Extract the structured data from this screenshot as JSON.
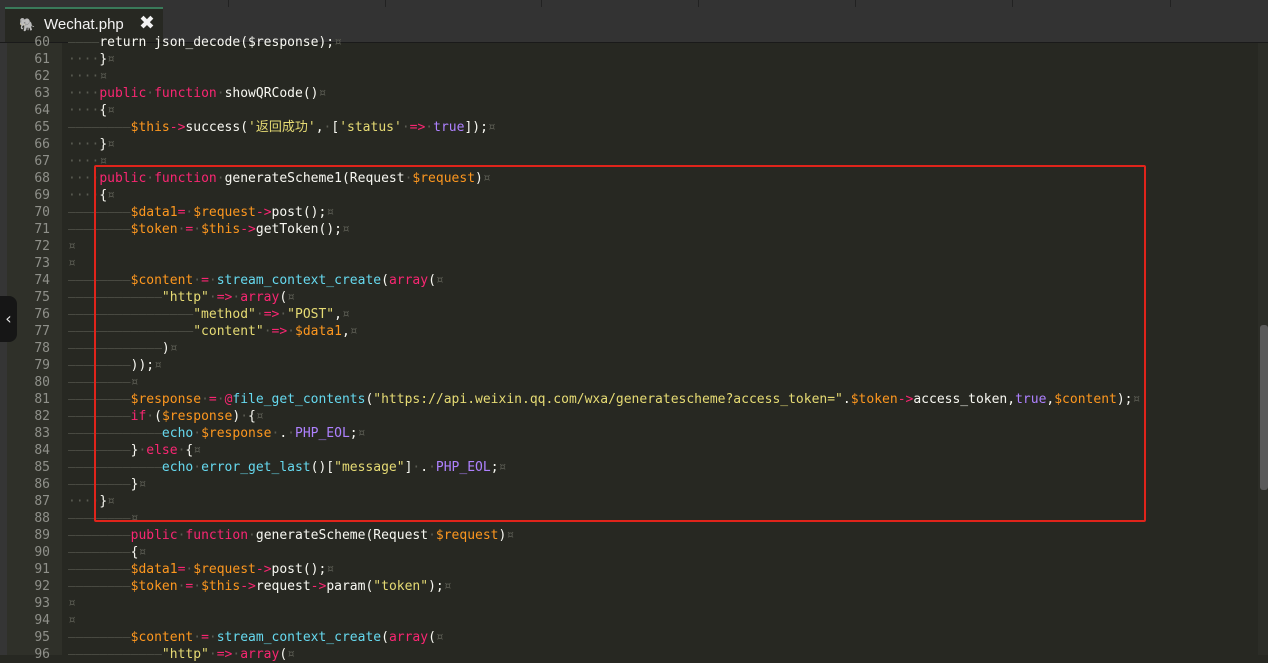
{
  "tab": {
    "title": "Wechat.php",
    "close_glyph": "✖",
    "icon": "elephant-php-icon"
  },
  "colors": {
    "keyword": "#f92672",
    "function": "#66d9ef",
    "variable": "#fd971f",
    "string": "#e6db74",
    "constant": "#ae81ff",
    "highlight_box": "#e0241b"
  },
  "collapse_glyph": "‹",
  "lines": [
    {
      "n": "60",
      "t": [
        [
          "tab",
          "————"
        ],
        [
          "",
          "return json_decode($response);"
        ],
        [
          "pil",
          "¤"
        ]
      ]
    },
    {
      "n": "61",
      "t": [
        [
          "ws",
          "····"
        ],
        [
          "",
          "}"
        ],
        [
          "pil",
          "¤"
        ]
      ]
    },
    {
      "n": "62",
      "t": [
        [
          "ws",
          "····"
        ],
        [
          "pil",
          "¤"
        ]
      ]
    },
    {
      "n": "63",
      "t": [
        [
          "ws",
          "····"
        ],
        [
          "kw",
          "public"
        ],
        [
          "ws",
          "·"
        ],
        [
          "kw",
          "function"
        ],
        [
          "ws",
          "·"
        ],
        [
          "",
          "showQRCode()"
        ],
        [
          "pil",
          "¤"
        ]
      ]
    },
    {
      "n": "64",
      "t": [
        [
          "ws",
          "····"
        ],
        [
          "",
          "{"
        ],
        [
          "pil",
          "¤"
        ]
      ]
    },
    {
      "n": "65",
      "t": [
        [
          "tab",
          "————————"
        ],
        [
          "var",
          "$this"
        ],
        [
          "op",
          "->"
        ],
        [
          "",
          "success("
        ],
        [
          "str",
          "'返回成功'"
        ],
        [
          "",
          ","
        ],
        [
          "ws",
          "·"
        ],
        [
          "",
          "["
        ],
        [
          "str",
          "'status'"
        ],
        [
          "ws",
          "·"
        ],
        [
          "op",
          "=>"
        ],
        [
          "ws",
          "·"
        ],
        [
          "const",
          "true"
        ],
        [
          "",
          "]);"
        ],
        [
          "pil",
          "¤"
        ]
      ]
    },
    {
      "n": "66",
      "t": [
        [
          "ws",
          "····"
        ],
        [
          "",
          "}"
        ],
        [
          "pil",
          "¤"
        ]
      ]
    },
    {
      "n": "67",
      "t": [
        [
          "ws",
          "····"
        ],
        [
          "pil",
          "¤"
        ]
      ]
    },
    {
      "n": "68",
      "t": [
        [
          "ws",
          "····"
        ],
        [
          "kw",
          "public"
        ],
        [
          "ws",
          "·"
        ],
        [
          "kw",
          "function"
        ],
        [
          "ws",
          "·"
        ],
        [
          "",
          "generateScheme1(Request"
        ],
        [
          "ws",
          "·"
        ],
        [
          "var",
          "$request"
        ],
        [
          "",
          ")"
        ],
        [
          "pil",
          "¤"
        ]
      ]
    },
    {
      "n": "69",
      "t": [
        [
          "ws",
          "····"
        ],
        [
          "",
          "{"
        ],
        [
          "pil",
          "¤"
        ]
      ]
    },
    {
      "n": "70",
      "t": [
        [
          "tab",
          "————————"
        ],
        [
          "var",
          "$data1"
        ],
        [
          "op",
          "="
        ],
        [
          "ws",
          "·"
        ],
        [
          "var",
          "$request"
        ],
        [
          "op",
          "->"
        ],
        [
          "",
          "post();"
        ],
        [
          "pil",
          "¤"
        ]
      ]
    },
    {
      "n": "71",
      "t": [
        [
          "tab",
          "————————"
        ],
        [
          "var",
          "$token"
        ],
        [
          "ws",
          "·"
        ],
        [
          "op",
          "="
        ],
        [
          "ws",
          "·"
        ],
        [
          "var",
          "$this"
        ],
        [
          "op",
          "->"
        ],
        [
          "",
          "getToken();"
        ],
        [
          "pil",
          "¤"
        ]
      ]
    },
    {
      "n": "72",
      "t": [
        [
          "pil",
          "¤"
        ]
      ]
    },
    {
      "n": "73",
      "t": [
        [
          "pil",
          "¤"
        ]
      ]
    },
    {
      "n": "74",
      "t": [
        [
          "tab",
          "————————"
        ],
        [
          "var",
          "$content"
        ],
        [
          "ws",
          "·"
        ],
        [
          "op",
          "="
        ],
        [
          "ws",
          "·"
        ],
        [
          "fn",
          "stream_context_create"
        ],
        [
          "",
          "("
        ],
        [
          "kw",
          "array"
        ],
        [
          "",
          "("
        ],
        [
          "pil",
          "¤"
        ]
      ]
    },
    {
      "n": "75",
      "t": [
        [
          "tab",
          "————————————"
        ],
        [
          "str",
          "\"http\""
        ],
        [
          "ws",
          "·"
        ],
        [
          "op",
          "=>"
        ],
        [
          "ws",
          "·"
        ],
        [
          "kw",
          "array"
        ],
        [
          "",
          "("
        ],
        [
          "pil",
          "¤"
        ]
      ]
    },
    {
      "n": "76",
      "t": [
        [
          "tab",
          "————————————————"
        ],
        [
          "str",
          "\"method\""
        ],
        [
          "ws",
          "·"
        ],
        [
          "op",
          "=>"
        ],
        [
          "ws",
          "·"
        ],
        [
          "str",
          "\"POST\""
        ],
        [
          "",
          ","
        ],
        [
          "pil",
          "¤"
        ]
      ]
    },
    {
      "n": "77",
      "t": [
        [
          "tab",
          "————————————————"
        ],
        [
          "str",
          "\"content\""
        ],
        [
          "ws",
          "·"
        ],
        [
          "op",
          "=>"
        ],
        [
          "ws",
          "·"
        ],
        [
          "var",
          "$data1"
        ],
        [
          "",
          ","
        ],
        [
          "pil",
          "¤"
        ]
      ]
    },
    {
      "n": "78",
      "t": [
        [
          "tab",
          "————————————"
        ],
        [
          "",
          ")"
        ],
        [
          "pil",
          "¤"
        ]
      ]
    },
    {
      "n": "79",
      "t": [
        [
          "tab",
          "————————"
        ],
        [
          "",
          "));"
        ],
        [
          "pil",
          "¤"
        ]
      ]
    },
    {
      "n": "80",
      "t": [
        [
          "tab",
          "————————"
        ],
        [
          "pil",
          "¤"
        ]
      ]
    },
    {
      "n": "81",
      "t": [
        [
          "tab",
          "————————"
        ],
        [
          "var",
          "$response"
        ],
        [
          "ws",
          "·"
        ],
        [
          "op",
          "="
        ],
        [
          "ws",
          "·"
        ],
        [
          "op",
          "@"
        ],
        [
          "fn",
          "file_get_contents"
        ],
        [
          "",
          "("
        ],
        [
          "str",
          "\"https://api.weixin.qq.com/wxa/generatescheme?access_token=\""
        ],
        [
          "",
          "."
        ],
        [
          "var",
          "$token"
        ],
        [
          "op",
          "->"
        ],
        [
          "",
          "access_token,"
        ],
        [
          "const",
          "true"
        ],
        [
          "",
          ","
        ],
        [
          "var",
          "$content"
        ],
        [
          "",
          ");"
        ],
        [
          "pil",
          "¤"
        ]
      ]
    },
    {
      "n": "82",
      "t": [
        [
          "tab",
          "————————"
        ],
        [
          "kw",
          "if"
        ],
        [
          "ws",
          "·"
        ],
        [
          "",
          "("
        ],
        [
          "var",
          "$response"
        ],
        [
          "",
          ")"
        ],
        [
          "ws",
          "·"
        ],
        [
          "",
          "{"
        ],
        [
          "pil",
          "¤"
        ]
      ]
    },
    {
      "n": "83",
      "t": [
        [
          "tab",
          "————————————"
        ],
        [
          "fn",
          "echo"
        ],
        [
          "ws",
          "·"
        ],
        [
          "var",
          "$response"
        ],
        [
          "ws",
          "·"
        ],
        [
          "",
          "."
        ],
        [
          "ws",
          "·"
        ],
        [
          "const",
          "PHP_EOL"
        ],
        [
          "",
          ";"
        ],
        [
          "pil",
          "¤"
        ]
      ]
    },
    {
      "n": "84",
      "t": [
        [
          "tab",
          "————————"
        ],
        [
          "",
          "}"
        ],
        [
          "ws",
          "·"
        ],
        [
          "kw",
          "else"
        ],
        [
          "ws",
          "·"
        ],
        [
          "",
          "{"
        ],
        [
          "pil",
          "¤"
        ]
      ]
    },
    {
      "n": "85",
      "t": [
        [
          "tab",
          "————————————"
        ],
        [
          "fn",
          "echo"
        ],
        [
          "ws",
          "·"
        ],
        [
          "fn",
          "error_get_last"
        ],
        [
          "",
          "()["
        ],
        [
          "str",
          "\"message\""
        ],
        [
          "",
          "]"
        ],
        [
          "ws",
          "·"
        ],
        [
          "",
          "."
        ],
        [
          "ws",
          "·"
        ],
        [
          "const",
          "PHP_EOL"
        ],
        [
          "",
          ";"
        ],
        [
          "pil",
          "¤"
        ]
      ]
    },
    {
      "n": "86",
      "t": [
        [
          "tab",
          "————————"
        ],
        [
          "",
          "}"
        ],
        [
          "pil",
          "¤"
        ]
      ]
    },
    {
      "n": "87",
      "t": [
        [
          "ws",
          "····"
        ],
        [
          "",
          "}"
        ],
        [
          "pil",
          "¤"
        ]
      ]
    },
    {
      "n": "88",
      "t": [
        [
          "tab",
          "————————"
        ],
        [
          "pil",
          "¤"
        ]
      ]
    },
    {
      "n": "89",
      "t": [
        [
          "tab",
          "————————"
        ],
        [
          "kw",
          "public"
        ],
        [
          "ws",
          "·"
        ],
        [
          "kw",
          "function"
        ],
        [
          "ws",
          "·"
        ],
        [
          "",
          "generateScheme(Request"
        ],
        [
          "ws",
          "·"
        ],
        [
          "var",
          "$request"
        ],
        [
          "",
          ")"
        ],
        [
          "pil",
          "¤"
        ]
      ]
    },
    {
      "n": "90",
      "t": [
        [
          "tab",
          "————————"
        ],
        [
          "",
          "{"
        ],
        [
          "pil",
          "¤"
        ]
      ]
    },
    {
      "n": "91",
      "t": [
        [
          "tab",
          "————————"
        ],
        [
          "var",
          "$data1"
        ],
        [
          "op",
          "="
        ],
        [
          "ws",
          "·"
        ],
        [
          "var",
          "$request"
        ],
        [
          "op",
          "->"
        ],
        [
          "",
          "post();"
        ],
        [
          "pil",
          "¤"
        ]
      ]
    },
    {
      "n": "92",
      "t": [
        [
          "tab",
          "————————"
        ],
        [
          "var",
          "$token"
        ],
        [
          "ws",
          "·"
        ],
        [
          "op",
          "="
        ],
        [
          "ws",
          "·"
        ],
        [
          "var",
          "$this"
        ],
        [
          "op",
          "->"
        ],
        [
          "",
          "request"
        ],
        [
          "op",
          "->"
        ],
        [
          "",
          "param("
        ],
        [
          "str",
          "\"token\""
        ],
        [
          "",
          ");"
        ],
        [
          "pil",
          "¤"
        ]
      ]
    },
    {
      "n": "93",
      "t": [
        [
          "pil",
          "¤"
        ]
      ]
    },
    {
      "n": "94",
      "t": [
        [
          "pil",
          "¤"
        ]
      ]
    },
    {
      "n": "95",
      "t": [
        [
          "tab",
          "————————"
        ],
        [
          "var",
          "$content"
        ],
        [
          "ws",
          "·"
        ],
        [
          "op",
          "="
        ],
        [
          "ws",
          "·"
        ],
        [
          "fn",
          "stream_context_create"
        ],
        [
          "",
          "("
        ],
        [
          "kw",
          "array"
        ],
        [
          "",
          "("
        ],
        [
          "pil",
          "¤"
        ]
      ]
    },
    {
      "n": "96",
      "t": [
        [
          "tab",
          "————————————"
        ],
        [
          "str",
          "\"http\""
        ],
        [
          "ws",
          "·"
        ],
        [
          "op",
          "=>"
        ],
        [
          "ws",
          "·"
        ],
        [
          "kw",
          "array"
        ],
        [
          "",
          "("
        ],
        [
          "pil",
          "¤"
        ]
      ]
    }
  ]
}
